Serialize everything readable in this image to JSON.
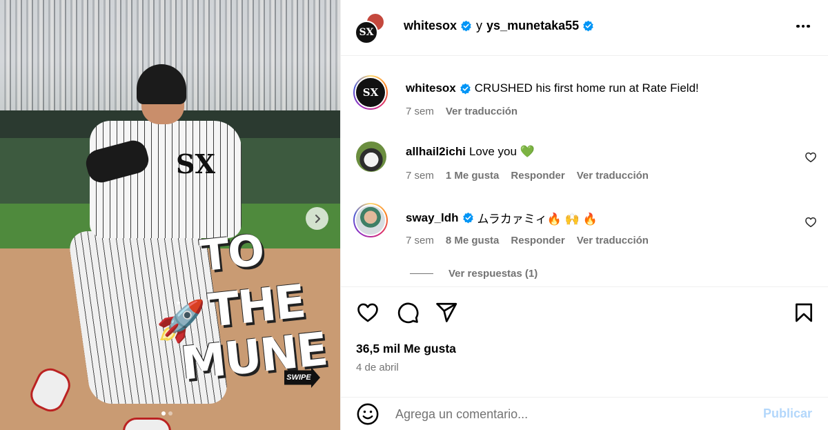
{
  "header": {
    "author": "whitesox",
    "conjunction": "y",
    "coauthor": "ys_munetaka55",
    "avatar_logo": "SX",
    "more_icon": "more-horizontal-icon"
  },
  "media": {
    "overlay_line1": "TO",
    "overlay_line2": "THE",
    "overlay_line3": "MUNE",
    "rocket": "🚀",
    "swipe_label": "SWIPE",
    "jersey_logo": "SX",
    "carousel_position": 1,
    "carousel_total": 2
  },
  "caption": {
    "user": "whitesox",
    "text": "CRUSHED his first home run at Rate Field!",
    "time": "7 sem",
    "translate": "Ver traducción",
    "avatar_logo": "SX"
  },
  "comments": [
    {
      "user": "allhail2ichi",
      "text": "Love you 💚",
      "time": "7 sem",
      "likes": "1 Me gusta",
      "reply": "Responder",
      "translate": "Ver traducción"
    },
    {
      "user": "sway_ldh",
      "text": "ムラカァミィ🔥 🙌 🔥",
      "time": "7 sem",
      "likes": "8 Me gusta",
      "reply": "Responder",
      "translate": "Ver traducción"
    }
  ],
  "view_replies": "Ver respuestas (1)",
  "post": {
    "likes": "36,5 mil Me gusta",
    "date": "4 de abril"
  },
  "composer": {
    "placeholder": "Agrega un comentario...",
    "publish": "Publicar"
  },
  "colors": {
    "verified": "#0095f6",
    "secondary_text": "#737373",
    "publish_disabled": "#b3d7fb"
  }
}
